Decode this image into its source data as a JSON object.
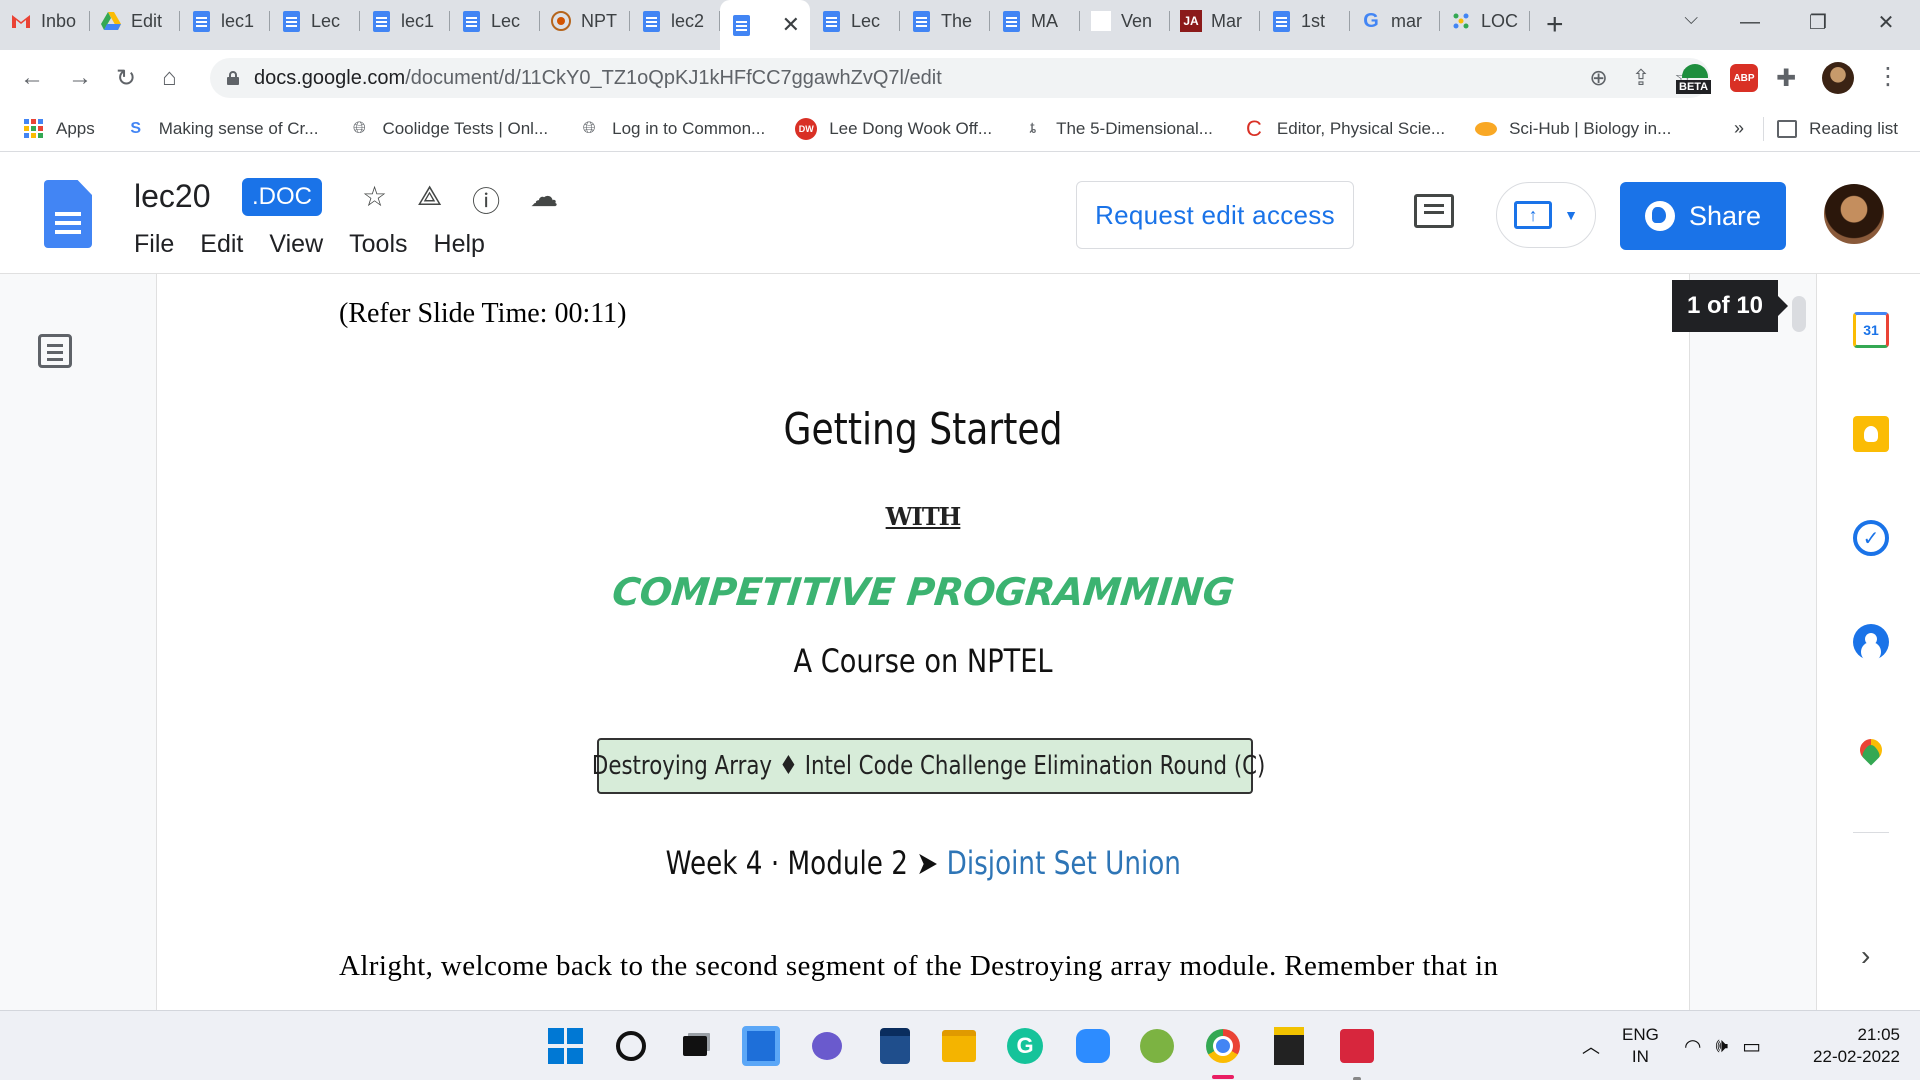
{
  "browser": {
    "tabs": [
      {
        "title": "Inbo",
        "icon": "gmail-icon"
      },
      {
        "title": "Edit",
        "icon": "drive-icon"
      },
      {
        "title": "lec1",
        "icon": "docs-icon"
      },
      {
        "title": "Lec",
        "icon": "docs-icon"
      },
      {
        "title": "lec1",
        "icon": "docs-icon"
      },
      {
        "title": "Lec",
        "icon": "docs-icon"
      },
      {
        "title": "NPT",
        "icon": "nptel-icon"
      },
      {
        "title": "lec2",
        "icon": "docs-icon"
      },
      {
        "title": "",
        "icon": "docs-icon",
        "active": true
      },
      {
        "title": "Lec",
        "icon": "docs-icon"
      },
      {
        "title": "The",
        "icon": "docs-icon"
      },
      {
        "title": "MA",
        "icon": "docs-icon"
      },
      {
        "title": "Ven",
        "icon": "blank-icon"
      },
      {
        "title": "Mar",
        "icon": "ja-icon"
      },
      {
        "title": "1st",
        "icon": "docs-icon"
      },
      {
        "title": "mar",
        "icon": "google-icon"
      },
      {
        "title": "LOC",
        "icon": "loc-icon"
      }
    ],
    "new_tab_symbol": "+",
    "close_symbol": "✕",
    "url_host": "docs.google.com",
    "url_path": "/document/d/11CkY0_TZ1oQpKJ1kHFfCC7ggawhZvQ7l/edit",
    "extensions": {
      "beta_label": "BETA",
      "abp_label": "ABP"
    },
    "bookmarks": [
      {
        "label": "Apps",
        "icon": "apps-grid-icon"
      },
      {
        "label": "Making sense of Cr...",
        "icon": "link-icon"
      },
      {
        "label": "Coolidge Tests | Onl...",
        "icon": "globe-icon"
      },
      {
        "label": "Log in to Common...",
        "icon": "globe-icon"
      },
      {
        "label": "Lee Dong Wook Off...",
        "icon": "dw-icon"
      },
      {
        "label": "The 5-Dimensional...",
        "icon": "figure-icon"
      },
      {
        "label": "Editor, Physical Scie...",
        "icon": "c-icon"
      },
      {
        "label": "Sci-Hub | Biology in...",
        "icon": "scihub-icon"
      }
    ],
    "bookmarks_more": "»",
    "reading_list": "Reading list"
  },
  "docs": {
    "title": "lec20",
    "badge": ".DOC",
    "menu": [
      "File",
      "Edit",
      "View",
      "Tools",
      "Help"
    ],
    "request_edit": "Request edit access",
    "share": "Share",
    "page_indicator": "1 of 10"
  },
  "document": {
    "refer": "(Refer Slide Time: 00:11)",
    "slide": {
      "title": "Getting Started",
      "with": "WITH",
      "program": "COMPETITIVE PROGRAMMING",
      "course": "A Course on NPTEL",
      "challenge": "Destroying Array ♦ Intel Code Challenge Elimination Round (C)",
      "week": "Week 4 · Module 2 ➤ ",
      "topic": "Disjoint Set Union"
    },
    "body": "Alright, welcome back to the second segment of the Destroying array module. Remember that in"
  },
  "sidepanel": {
    "calendar_day": "31"
  },
  "taskbar": {
    "lang_top": "ENG",
    "lang_bottom": "IN",
    "time": "21:05",
    "date": "22-02-2022"
  },
  "colors": {
    "accent": "#1a73e8",
    "program_green": "#3cb371",
    "topic_blue": "#2e75b6",
    "challenge_bg": "#d7ecd9"
  }
}
